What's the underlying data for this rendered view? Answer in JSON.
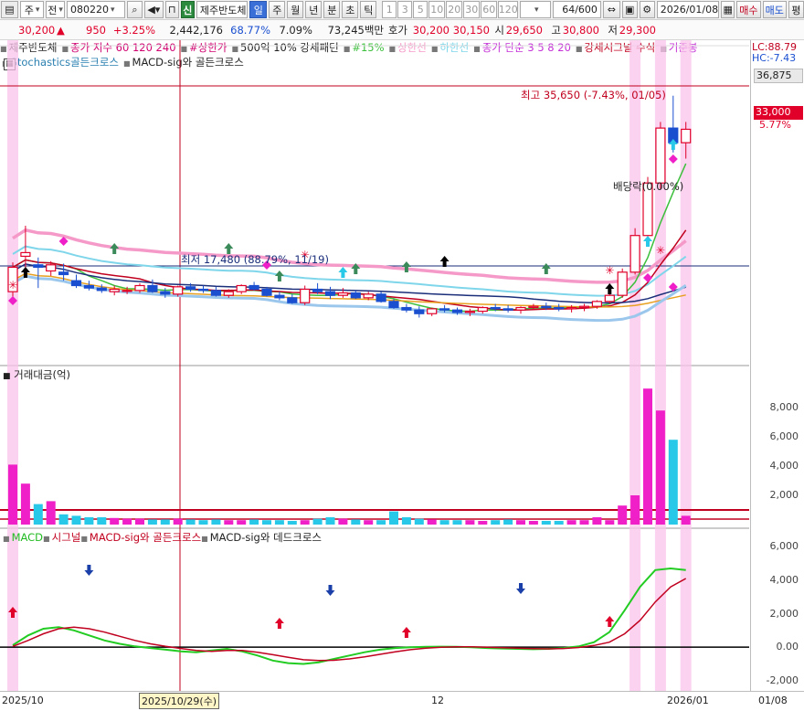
{
  "toolbar": {
    "market": "주",
    "period_sel": "전",
    "code": "080220",
    "badge_new": "신",
    "stock_name": "제주반도체",
    "tf_selected": "일",
    "timeframes": [
      "주",
      "월",
      "년",
      "분",
      "초",
      "틱"
    ],
    "intervals": [
      "1",
      "3",
      "5",
      "10",
      "20",
      "30",
      "60",
      "120"
    ],
    "count": "64/600",
    "date": "2026/01/08",
    "buy_label": "매수",
    "sell_label": "매도",
    "flat_label": "평"
  },
  "quote": {
    "price": "30,200",
    "change": "950",
    "change_pct": "+3.25%",
    "volume": "2,442,176",
    "vol_ratio": "68.77%",
    "turnover": "7.09%",
    "amount": "73,245백만",
    "hoga_label": "호가",
    "ask": "30,200",
    "bid": "30,150",
    "open_label": "시",
    "open": "29,650",
    "high_label": "고",
    "high": "30,800",
    "low_label": "저",
    "low": "29,300"
  },
  "legend": {
    "row1": [
      {
        "text": "제주반도체",
        "color": "#222222"
      },
      {
        "text": "종가 지수 60 120 240",
        "color": "#d0006f"
      },
      {
        "text": "#상한가",
        "color": "#d0006f"
      },
      {
        "text": "500억 10% 강세패턴",
        "color": "#222222"
      },
      {
        "text": "#15%",
        "color": "#3cbf3c"
      },
      {
        "text": "상한선",
        "color": "#f59ac8"
      },
      {
        "text": "하한선",
        "color": "#7fd6ea"
      },
      {
        "text": "종가 단순 3 5 8 20",
        "color": "#c42fd6"
      },
      {
        "text": "강세시그널 수식",
        "color": "#c0001e"
      },
      {
        "text": "기준봉",
        "color": "#c42fd6"
      }
    ],
    "row2": [
      {
        "text": "Stochastics골든크로스",
        "color": "#2a7fb0"
      },
      {
        "text": "MACD-sig와 골든크로스",
        "color": "#222222"
      }
    ],
    "lc": "LC:88.79",
    "hc": "HC:-7.43"
  },
  "price_axis": {
    "top_label": "36,875",
    "current": "33,000",
    "current_pct": "5.77%"
  },
  "annotations": {
    "high": "최고 35,650 (-7.43%, 01/05)",
    "low": "최저 17,480 (88.79%, 11/19)",
    "dividend": "배당락(0.00%)"
  },
  "volume_pane": {
    "title": "거래대금(억)",
    "ticks": [
      "8,000",
      "6,000",
      "4,000",
      "2,000"
    ]
  },
  "macd_pane": {
    "labels": [
      {
        "text": "MACD",
        "color": "#22bb22"
      },
      {
        "text": "시그널",
        "color": "#c0001e"
      },
      {
        "text": "MACD-sig와 골든크로스",
        "color": "#c0001e"
      },
      {
        "text": "MACD-sig와 데드크로스",
        "color": "#222222"
      }
    ],
    "ticks": [
      "6,000",
      "4,000",
      "2,000",
      "0.00",
      "-2,000"
    ]
  },
  "date_axis": {
    "left": "2025/10",
    "cursor": "2025/10/29(수)",
    "mid": "12",
    "right1": "2026/01",
    "right2": "01/08"
  },
  "chart_data": {
    "type": "candlestick",
    "title": "제주반도체",
    "candles_ohlc": [
      [
        19600,
        22000,
        19200,
        21600
      ],
      [
        22500,
        25000,
        21500,
        22800
      ],
      [
        21800,
        22400,
        19900,
        21600
      ],
      [
        21300,
        22100,
        20900,
        21800
      ],
      [
        21200,
        21900,
        20500,
        21000
      ],
      [
        20500,
        21000,
        19900,
        20100
      ],
      [
        20100,
        20500,
        19700,
        19900
      ],
      [
        19900,
        20200,
        19500,
        19700
      ],
      [
        19600,
        20100,
        19300,
        19800
      ],
      [
        19700,
        20000,
        19400,
        19700
      ],
      [
        19700,
        20300,
        19500,
        20100
      ],
      [
        20100,
        20600,
        19500,
        19600
      ],
      [
        19600,
        19900,
        19100,
        19400
      ],
      [
        19400,
        20100,
        19200,
        20000
      ],
      [
        20000,
        20300,
        19600,
        19800
      ],
      [
        19800,
        20100,
        19500,
        19700
      ],
      [
        19700,
        20000,
        19200,
        19300
      ],
      [
        19300,
        19800,
        19100,
        19600
      ],
      [
        19600,
        20200,
        19400,
        20100
      ],
      [
        20100,
        20400,
        19700,
        19800
      ],
      [
        19800,
        20000,
        19200,
        19300
      ],
      [
        19300,
        19600,
        18900,
        19100
      ],
      [
        19100,
        19400,
        18600,
        18700
      ],
      [
        18700,
        20100,
        18500,
        19800
      ],
      [
        19800,
        20300,
        19400,
        19600
      ],
      [
        19600,
        20000,
        19000,
        19300
      ],
      [
        19300,
        19900,
        19100,
        19500
      ],
      [
        19500,
        19700,
        19000,
        19100
      ],
      [
        19100,
        19600,
        18900,
        19400
      ],
      [
        19400,
        19600,
        18700,
        18800
      ],
      [
        18800,
        19000,
        18200,
        18300
      ],
      [
        18300,
        18600,
        17900,
        18100
      ],
      [
        18100,
        18400,
        17480,
        17800
      ],
      [
        17800,
        18300,
        17600,
        18200
      ],
      [
        18200,
        18500,
        17900,
        18100
      ],
      [
        18100,
        18300,
        17700,
        17900
      ],
      [
        17900,
        18200,
        17600,
        18000
      ],
      [
        18000,
        18400,
        17800,
        18300
      ],
      [
        18300,
        18600,
        18000,
        18200
      ],
      [
        18200,
        18500,
        17900,
        18100
      ],
      [
        18100,
        18400,
        17800,
        18300
      ],
      [
        18300,
        18600,
        18100,
        18400
      ],
      [
        18400,
        18700,
        18100,
        18300
      ],
      [
        18300,
        18600,
        18000,
        18200
      ],
      [
        18200,
        18500,
        17900,
        18300
      ],
      [
        18300,
        18600,
        18000,
        18400
      ],
      [
        18400,
        18900,
        18200,
        18800
      ],
      [
        18800,
        19400,
        18600,
        19300
      ],
      [
        19300,
        21500,
        19100,
        21200
      ],
      [
        21200,
        24800,
        21000,
        24200
      ],
      [
        24200,
        29000,
        23800,
        28500
      ],
      [
        28500,
        33500,
        28000,
        33000
      ],
      [
        33000,
        35650,
        31000,
        31800
      ],
      [
        31800,
        33500,
        30500,
        32900
      ]
    ],
    "ma_series_note": "moving averages shown as colored lines",
    "annotations": [
      "최고 35,650 (-7.43%, 01/05)",
      "최저 17,480 (88.79%, 11/19)",
      "배당락(0.00%)"
    ],
    "volume_amount_100m_won": [
      4100,
      2800,
      1400,
      1600,
      700,
      600,
      500,
      500,
      450,
      400,
      400,
      350,
      350,
      400,
      350,
      300,
      350,
      300,
      300,
      350,
      300,
      300,
      250,
      300,
      400,
      500,
      400,
      350,
      300,
      300,
      900,
      500,
      400,
      350,
      300,
      300,
      300,
      250,
      300,
      350,
      300,
      250,
      250,
      250,
      300,
      300,
      500,
      300,
      1300,
      2000,
      9300,
      7800,
      5800,
      600
    ],
    "macd": [
      120,
      700,
      1100,
      1200,
      1000,
      700,
      400,
      200,
      50,
      -50,
      -150,
      -250,
      -300,
      -200,
      -100,
      -250,
      -500,
      -800,
      -950,
      -1000,
      -900,
      -700,
      -500,
      -300,
      -150,
      -50,
      0,
      20,
      30,
      20,
      0,
      -50,
      -80,
      -100,
      -120,
      -100,
      -50,
      50,
      300,
      900,
      2200,
      3600,
      4600,
      4700,
      4600
    ],
    "signal": [
      50,
      400,
      800,
      1100,
      1200,
      1100,
      900,
      650,
      400,
      200,
      50,
      -80,
      -200,
      -250,
      -200,
      -200,
      -300,
      -450,
      -600,
      -750,
      -800,
      -780,
      -700,
      -580,
      -430,
      -280,
      -150,
      -60,
      0,
      20,
      20,
      0,
      -30,
      -60,
      -90,
      -100,
      -80,
      -20,
      100,
      300,
      800,
      1600,
      2700,
      3600,
      4100
    ],
    "volume_ylim": [
      0,
      10000
    ],
    "macd_ylim": [
      -2500,
      6500
    ]
  }
}
